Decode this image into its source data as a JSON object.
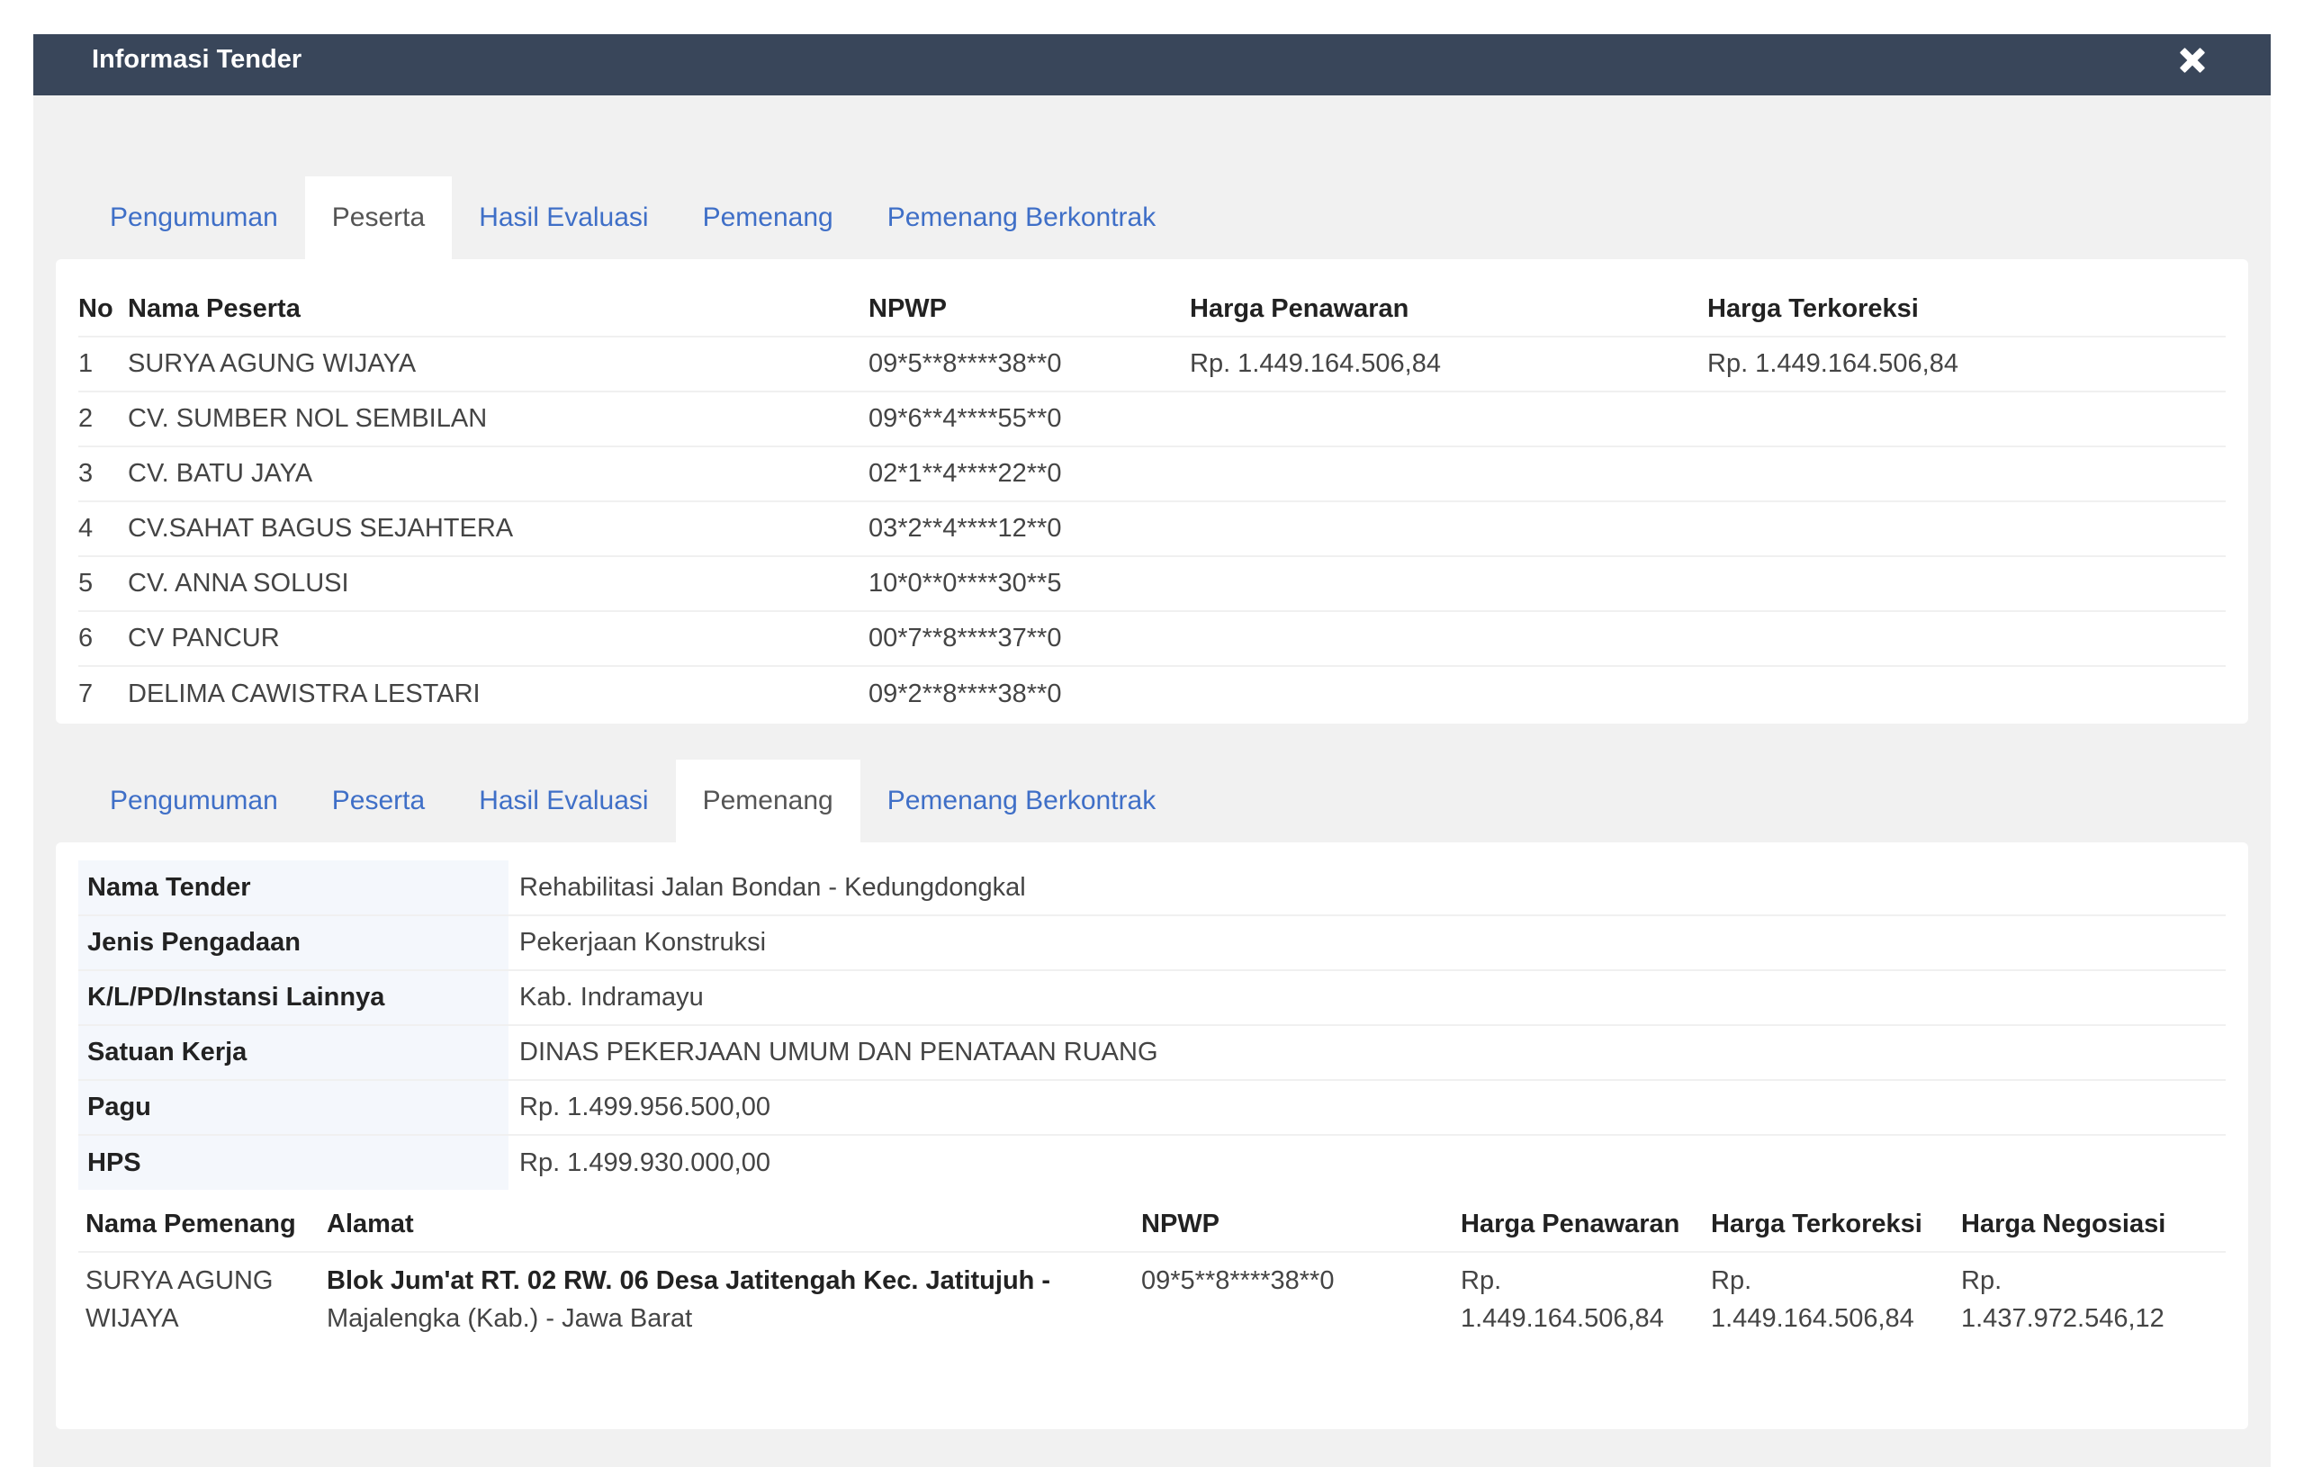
{
  "header": {
    "title": "Informasi Tender"
  },
  "tabs": [
    "Pengumuman",
    "Peserta",
    "Hasil Evaluasi",
    "Pemenang",
    "Pemenang Berkontrak"
  ],
  "peserta": {
    "columns": [
      "No",
      "Nama Peserta",
      "NPWP",
      "Harga Penawaran",
      "Harga Terkoreksi"
    ],
    "rows": [
      {
        "no": "1",
        "nama": "SURYA AGUNG WIJAYA",
        "npwp": "09*5**8****38**0",
        "penawaran": "Rp. 1.449.164.506,84",
        "terkoreksi": "Rp. 1.449.164.506,84"
      },
      {
        "no": "2",
        "nama": "CV. SUMBER NOL SEMBILAN",
        "npwp": "09*6**4****55**0",
        "penawaran": "",
        "terkoreksi": ""
      },
      {
        "no": "3",
        "nama": "CV. BATU JAYA",
        "npwp": "02*1**4****22**0",
        "penawaran": "",
        "terkoreksi": ""
      },
      {
        "no": "4",
        "nama": "CV.SAHAT BAGUS SEJAHTERA",
        "npwp": "03*2**4****12**0",
        "penawaran": "",
        "terkoreksi": ""
      },
      {
        "no": "5",
        "nama": "CV. ANNA SOLUSI",
        "npwp": "10*0**0****30**5",
        "penawaran": "",
        "terkoreksi": ""
      },
      {
        "no": "6",
        "nama": "CV PANCUR",
        "npwp": "00*7**8****37**0",
        "penawaran": "",
        "terkoreksi": ""
      },
      {
        "no": "7",
        "nama": "DELIMA CAWISTRA LESTARI",
        "npwp": "09*2**8****38**0",
        "penawaran": "",
        "terkoreksi": ""
      }
    ]
  },
  "pemenang": {
    "details": [
      {
        "label": "Nama Tender",
        "value": "Rehabilitasi Jalan Bondan - Kedungdongkal"
      },
      {
        "label": "Jenis Pengadaan",
        "value": "Pekerjaan Konstruksi"
      },
      {
        "label": "K/L/PD/Instansi Lainnya",
        "value": "Kab. Indramayu"
      },
      {
        "label": "Satuan Kerja",
        "value": "DINAS PEKERJAAN UMUM DAN PENATAAN RUANG"
      },
      {
        "label": "Pagu",
        "value": "Rp. 1.499.956.500,00"
      },
      {
        "label": "HPS",
        "value": "Rp. 1.499.930.000,00"
      }
    ],
    "winner_columns": [
      "Nama Pemenang",
      "Alamat",
      "NPWP",
      "Harga Penawaran",
      "Harga Terkoreksi",
      "Harga Negosiasi"
    ],
    "winner": {
      "nama": "SURYA AGUNG WIJAYA",
      "alamat_bold": "Blok Jum'at RT. 02 RW. 06 Desa Jatitengah Kec. Jatitujuh -",
      "alamat_rest": "Majalengka (Kab.) - Jawa Barat",
      "npwp": "09*5**8****38**0",
      "penawaran": "Rp. 1.449.164.506,84",
      "terkoreksi": "Rp. 1.449.164.506,84",
      "negosiasi": "Rp. 1.437.972.546,12"
    }
  }
}
